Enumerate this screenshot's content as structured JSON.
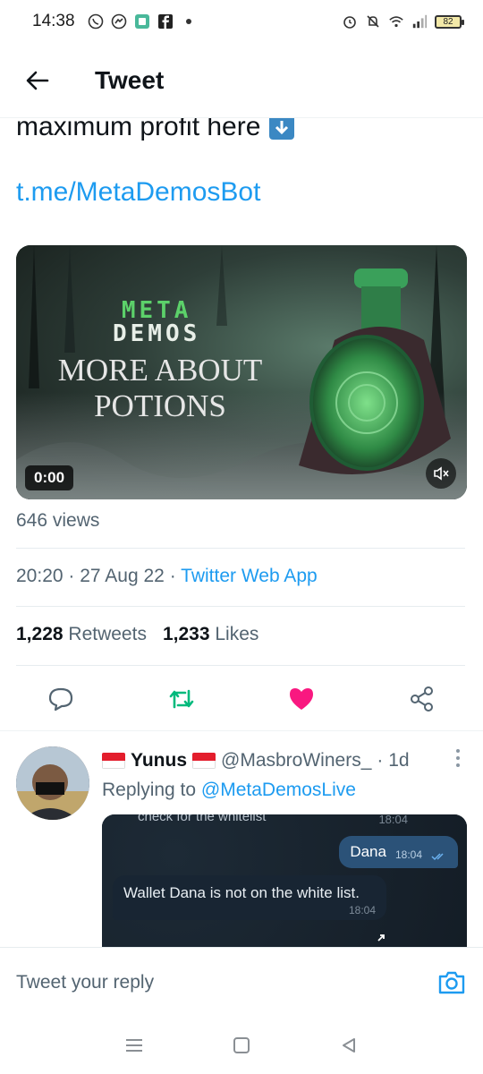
{
  "status_bar": {
    "time": "14:38",
    "battery": "82",
    "icons": [
      "viber-icon",
      "messenger-icon",
      "app-icon",
      "facebook-icon",
      "dot-icon",
      "alarm-icon",
      "mute-icon",
      "wifi-icon",
      "signal-icon"
    ]
  },
  "header": {
    "title": "Tweet"
  },
  "tweet": {
    "text": "maximum profit here",
    "link": "t.me/MetaDemosBot",
    "media": {
      "brand_line1": "META",
      "brand_line2": "DEMOS",
      "headline_line1": "MORE ABOUT",
      "headline_line2": "POTIONS",
      "time": "0:00"
    },
    "views": "646 views",
    "time": "20:20",
    "date": "27 Aug 22",
    "source": "Twitter Web App",
    "sep": "·",
    "retweets_count": "1,228",
    "retweets_label": "Retweets",
    "likes_count": "1,233",
    "likes_label": "Likes"
  },
  "reply": {
    "name": "Yunus",
    "handle": "@MasbroWiners_",
    "age": "· 1d",
    "replying_prefix": "Replying to",
    "replying_to": "@MetaDemosLive",
    "image": {
      "top_text": "check for the whitelist",
      "top_stamp": "18:04",
      "out_text": "Dana",
      "out_stamp": "18:04",
      "in_text": "Wallet Dana is not on the white list.",
      "in_stamp": "18:04"
    }
  },
  "reply_bar": {
    "placeholder": "Tweet your reply"
  },
  "colors": {
    "accent": "#1d9bf0",
    "retweet": "#00ba7c",
    "like": "#f91880"
  }
}
